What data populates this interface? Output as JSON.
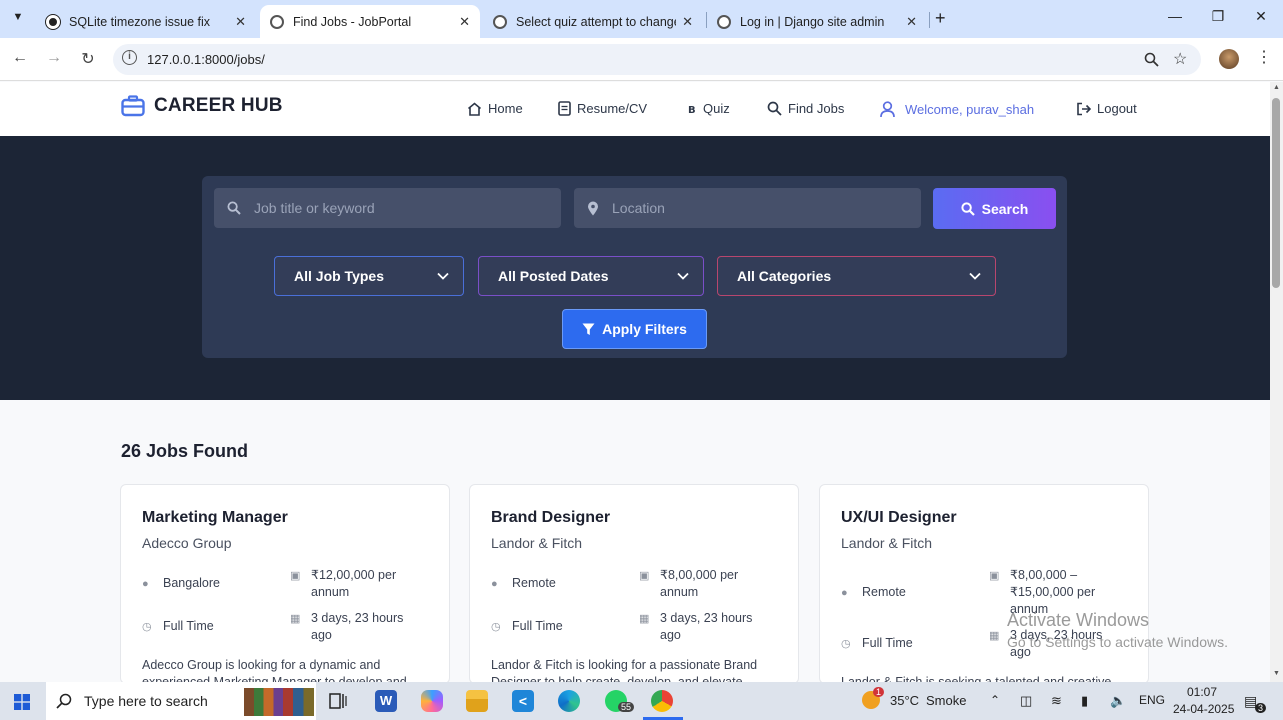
{
  "browser": {
    "tabs": [
      {
        "title": "SQLite timezone issue fix",
        "active": false
      },
      {
        "title": "Find Jobs - JobPortal",
        "active": true
      },
      {
        "title": "Select quiz attempt to change |",
        "active": false
      },
      {
        "title": "Log in | Django site admin",
        "active": false
      }
    ],
    "url": "127.0.0.1:8000/jobs/"
  },
  "site": {
    "brand": "CAREER HUB",
    "nav": {
      "home": "Home",
      "resume": "Resume/CV",
      "quiz": "Quiz",
      "find_jobs": "Find Jobs",
      "welcome": "Welcome, purav_shah",
      "logout": "Logout"
    }
  },
  "search": {
    "keyword_placeholder": "Job title or keyword",
    "location_placeholder": "Location",
    "search_label": "Search",
    "job_types": "All Job Types",
    "posted_dates": "All Posted Dates",
    "categories": "All Categories",
    "apply_label": "Apply Filters"
  },
  "results": {
    "count_label": "26 Jobs Found",
    "jobs": [
      {
        "title": "Marketing Manager",
        "company": "Adecco Group",
        "location": "Bangalore",
        "salary": "₹12,00,000 per annum",
        "type": "Full Time",
        "posted": "3 days, 23 hours ago",
        "description": "Adecco Group is looking for a dynamic and experienced Marketing Manager to develop and"
      },
      {
        "title": "Brand Designer",
        "company": "Landor & Fitch",
        "location": "Remote",
        "salary": "₹8,00,000 per annum",
        "type": "Full Time",
        "posted": "3 days, 23 hours ago",
        "description": "Landor & Fitch is looking for a passionate Brand Designer to help create, develop, and elevate"
      },
      {
        "title": "UX/UI Designer",
        "company": "Landor & Fitch",
        "location": "Remote",
        "salary": "₹8,00,000 – ₹15,00,000 per annum",
        "type": "Full Time",
        "posted": "3 days, 23 hours ago",
        "description": "Landor & Fitch is seeking a talented and creative"
      }
    ]
  },
  "watermark": {
    "line1": "Activate Windows",
    "line2": "Go to Settings to activate Windows."
  },
  "taskbar": {
    "search_placeholder": "Type here to search",
    "weather_temp": "35°C",
    "weather_cond": "Smoke",
    "weather_badge": "1",
    "whatsapp_badge": "55",
    "language": "ENG",
    "time": "01:07",
    "date": "24-04-2025",
    "notif_count": "3"
  },
  "colors": {
    "accent": "#5b6ee1",
    "hero_bg": "#1c2536",
    "apply_btn": "#2d6bef"
  }
}
